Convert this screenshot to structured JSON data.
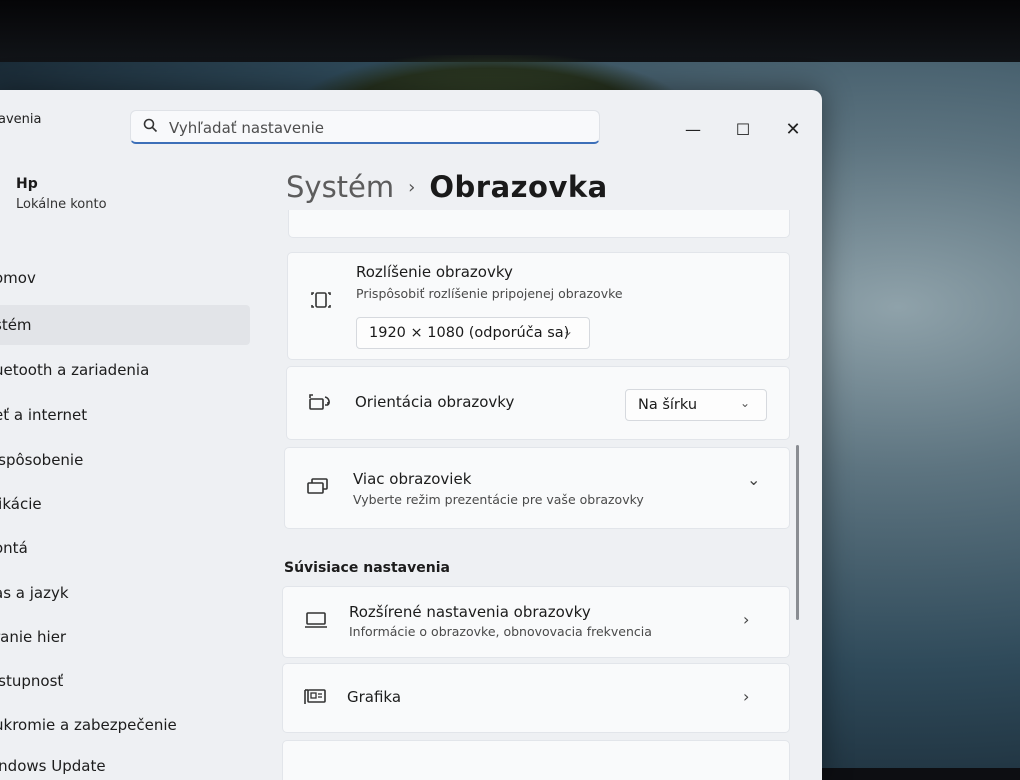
{
  "window": {
    "app_title": "avenia",
    "search": {
      "placeholder": "Vyhľadať nastavenie",
      "value": ""
    },
    "controls": {
      "minimize": "—",
      "maximize": "☐",
      "close": "✕"
    }
  },
  "user": {
    "name": "Hp",
    "account": "Lokálne konto"
  },
  "sidebar": {
    "items": [
      {
        "label": "omov"
      },
      {
        "label": "stém",
        "selected": true
      },
      {
        "label": "uetooth a zariadenia"
      },
      {
        "label": "eť a internet"
      },
      {
        "label": "ispôsobenie"
      },
      {
        "label": "likácie"
      },
      {
        "label": "ontá"
      },
      {
        "label": "as a jazyk"
      },
      {
        "label": "ranie hier"
      },
      {
        "label": "ístupnosť"
      },
      {
        "label": "ukromie a zabezpečenie"
      },
      {
        "label": "indows Update"
      }
    ]
  },
  "breadcrumb": {
    "parent": "Systém",
    "separator": "›",
    "current": "Obrazovka"
  },
  "cards": {
    "resolution": {
      "icon": "resolution-icon",
      "title": "Rozlíšenie obrazovky",
      "subtitle": "Prispôsobiť rozlíšenie pripojenej obrazovke",
      "value": "1920 × 1080 (odporúča sa)"
    },
    "orientation": {
      "icon": "orientation-icon",
      "title": "Orientácia obrazovky",
      "value": "Na šírku"
    },
    "multiple": {
      "icon": "multiple-displays-icon",
      "title": "Viac obrazoviek",
      "subtitle": "Vyberte režim prezentácie pre vaše obrazovky"
    }
  },
  "related": {
    "heading": "Súvisiace nastavenia",
    "advanced": {
      "icon": "monitor-icon",
      "title": "Rozšírené nastavenia obrazovky",
      "subtitle": "Informácie o obrazovke, obnovovacia frekvencia"
    },
    "graphics": {
      "icon": "graphics-card-icon",
      "title": "Grafika"
    }
  },
  "glyphs": {
    "chevron_down": "⌄",
    "chevron_right": "›",
    "search": "⌕"
  }
}
